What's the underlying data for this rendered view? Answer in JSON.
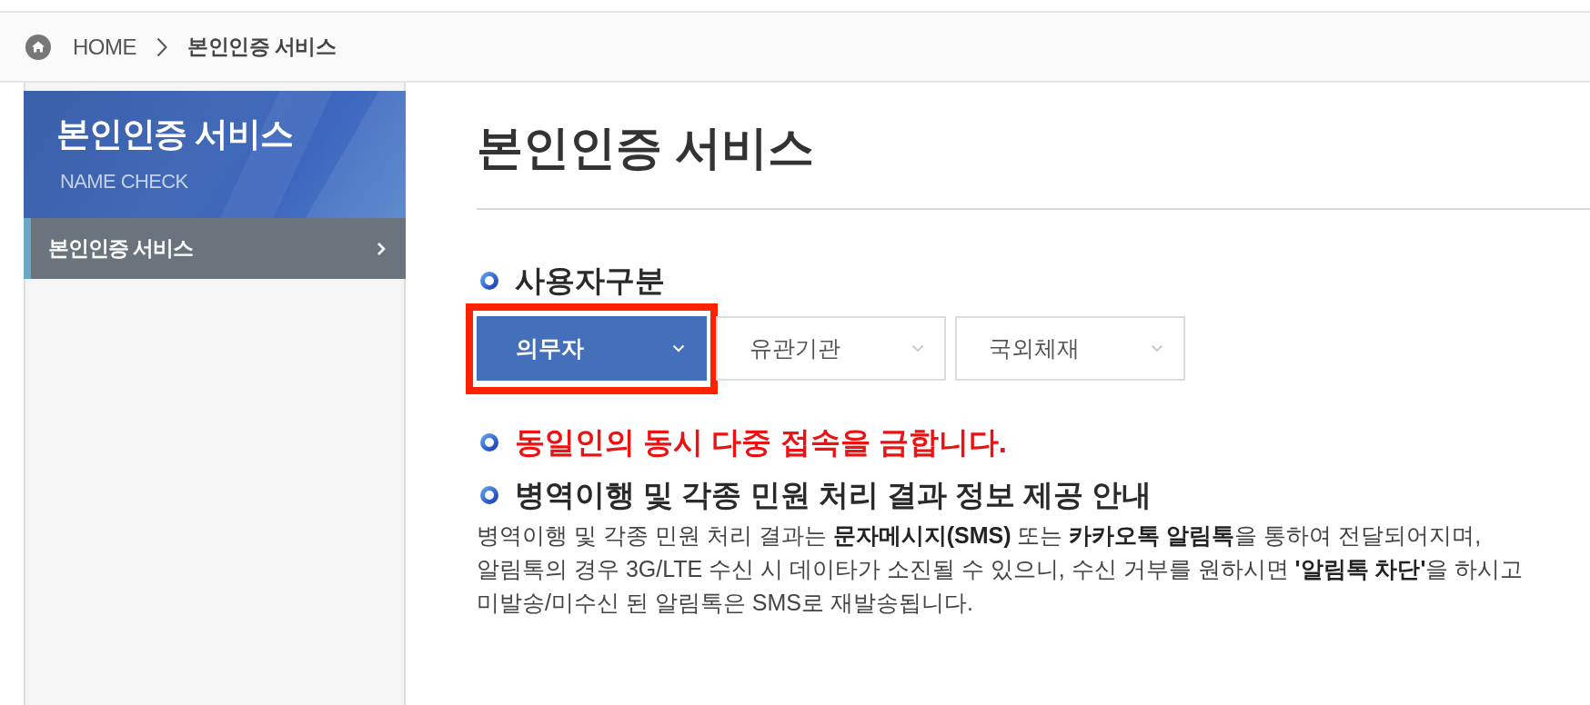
{
  "breadcrumb": {
    "home": "HOME",
    "current": "본인인증 서비스"
  },
  "sidebar": {
    "title": "본인인증 서비스",
    "subtitle": "NAME CHECK",
    "items": [
      {
        "label": "본인인증 서비스",
        "selected": true
      }
    ]
  },
  "page_title": "본인인증 서비스",
  "user_type": {
    "heading": "사용자구분",
    "options": [
      {
        "label": "의무자",
        "selected": true,
        "highlighted": true
      },
      {
        "label": "유관기관",
        "selected": false,
        "highlighted": false
      },
      {
        "label": "국외체재",
        "selected": false,
        "highlighted": false
      }
    ]
  },
  "notices": [
    {
      "kind": "warning",
      "text": "동일인의 동시 다중 접속을 금합니다."
    },
    {
      "kind": "info",
      "text": "병역이행 및 각종 민원 처리 결과 정보 제공 안내"
    }
  ],
  "description": "병역이행 및 각종 민원 처리 결과는 **문자메시지(SMS)** 또는 **카카오톡 알림톡**을 통하여 전달되어지며,\n알림톡의 경우 3G/LTE 수신 시 데이타가 소진될 수 있으니, 수신 거부를 원하시면 **'알림톡 차단'**을 하시고\n미발송/미수신 된 알림톡은 SMS로 재발송됩니다."
}
